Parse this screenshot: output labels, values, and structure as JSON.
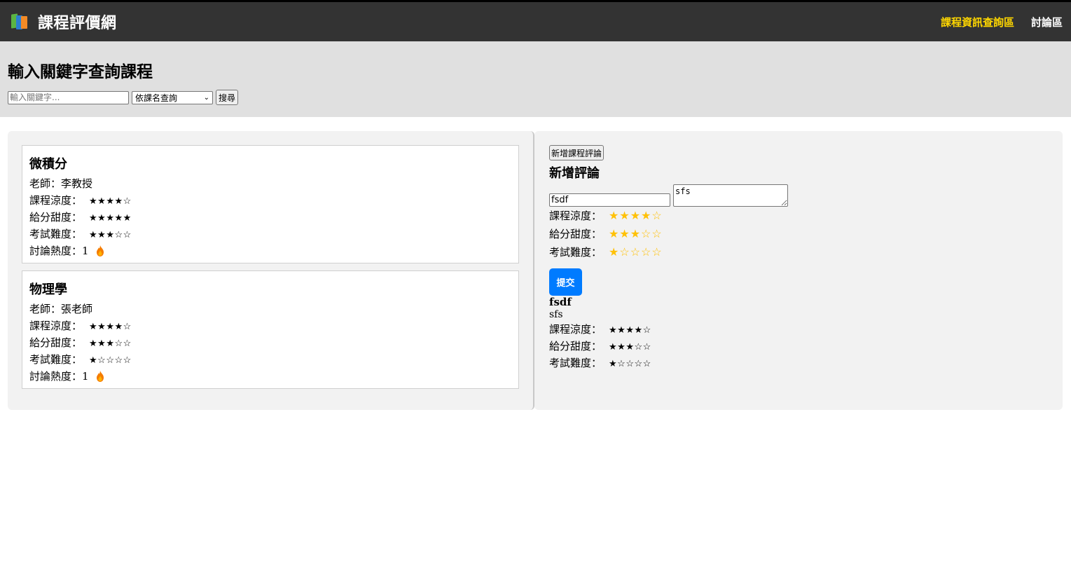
{
  "header": {
    "title": "課程評價網",
    "nav": [
      {
        "label": "課程資訊查詢區",
        "color": "#ffd700"
      },
      {
        "label": "討論區"
      }
    ]
  },
  "search": {
    "heading": "輸入關鍵字查詢課程",
    "placeholder": "輸入關鍵字...",
    "mode_selected": "依課名查詢",
    "button": "搜尋"
  },
  "courses": [
    {
      "name": "微積分",
      "teacher": "老師：李教授",
      "coolness_label": "課程涼度：",
      "coolness_stars": "★★★★☆",
      "grading_label": "給分甜度：",
      "grading_stars": "★★★★★",
      "exam_label": "考試難度：",
      "exam_stars": "★★★☆☆",
      "heat_label": "討論熱度：1"
    },
    {
      "name": "物理學",
      "teacher": "老師：張老師",
      "coolness_label": "課程涼度：",
      "coolness_stars": "★★★★☆",
      "grading_label": "給分甜度：",
      "grading_stars": "★★★☆☆",
      "exam_label": "考試難度：",
      "exam_stars": "★☆☆☆☆",
      "heat_label": "討論熱度：1"
    }
  ],
  "review_form": {
    "add_button": "新增課程評論",
    "heading": "新增評論",
    "title_value": "fsdf",
    "content_value": "sfs",
    "coolness_label": "課程涼度：",
    "coolness_stars": "★★★★☆",
    "grading_label": "給分甜度：",
    "grading_stars": "★★★☆☆",
    "exam_label": "考試難度：",
    "exam_stars": "★☆☆☆☆",
    "submit": "提交",
    "star_color": "#ffc107",
    "submit_color": "#007bff"
  },
  "reviews": [
    {
      "title": "fsdf",
      "content": "sfs",
      "coolness_label": "課程涼度：",
      "coolness_stars": "★★★★☆",
      "grading_label": "給分甜度：",
      "grading_stars": "★★★☆☆",
      "exam_label": "考試難度：",
      "exam_stars": "★☆☆☆☆"
    }
  ]
}
